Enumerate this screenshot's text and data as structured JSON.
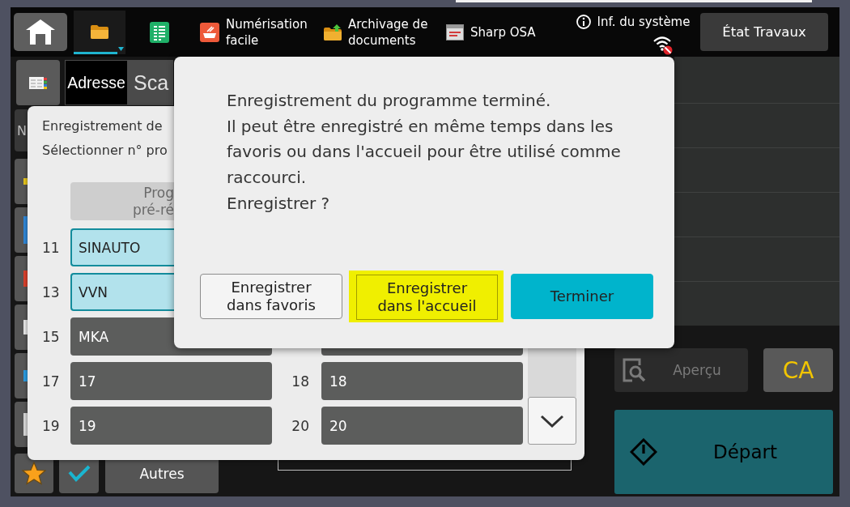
{
  "top_bar": {
    "shortcuts": [
      {
        "selected": true
      },
      {
        "selected": false
      },
      {
        "label": "Numérisation facile",
        "selected": false
      },
      {
        "label": "Archivage de documents",
        "selected": false
      },
      {
        "label": "Sharp OSA",
        "selected": false
      }
    ],
    "system_info": {
      "label": "Inf. du système"
    },
    "network": {
      "connected": false
    },
    "jobs_button": {
      "label": "État Travaux"
    }
  },
  "screen": {
    "address_button": {
      "label": "Adresse"
    },
    "mode_title": "Sca",
    "side_label": "N",
    "others_button": {
      "label": "Autres"
    },
    "preview_button": {
      "label": "Aperçu",
      "disabled": true
    },
    "clear_all_button": {
      "label": "CA"
    },
    "start_button": {
      "label": "Départ",
      "disabled": true
    }
  },
  "program_dialog": {
    "title": "Enregistrement de",
    "instruction": "Sélectionner n° pro",
    "preset_button": {
      "label": "Prog\npré-ré",
      "disabled": true
    },
    "rows": [
      {
        "left": {
          "number": "11",
          "name": "SINAUTO",
          "selected": true
        }
      },
      {
        "left": {
          "number": "13",
          "name": "VVN",
          "selected": true
        }
      },
      {
        "left": {
          "number": "15",
          "name": "MKA",
          "selected": false
        },
        "right": {
          "selected": false
        }
      },
      {
        "left": {
          "number": "17",
          "name": "17",
          "selected": false
        },
        "right": {
          "number": "18",
          "name": "18",
          "selected": false
        }
      },
      {
        "left": {
          "number": "19",
          "name": "19",
          "selected": false
        },
        "right": {
          "number": "20",
          "name": "20",
          "selected": false
        }
      }
    ]
  },
  "confirm_dialog": {
    "message": "Enregistrement du programme terminé.\nIl peut être enregistré en même temps dans les favoris ou dans l'accueil pour être utilisé comme raccourci.\nEnregistrer ?",
    "buttons": [
      {
        "label": "Enregistrer\ndans favoris",
        "kind": "secondary",
        "focused": false
      },
      {
        "label": "Enregistrer\ndans l'accueil",
        "kind": "secondary",
        "focused": true
      },
      {
        "label": "Terminer",
        "kind": "primary",
        "focused": false
      }
    ]
  }
}
